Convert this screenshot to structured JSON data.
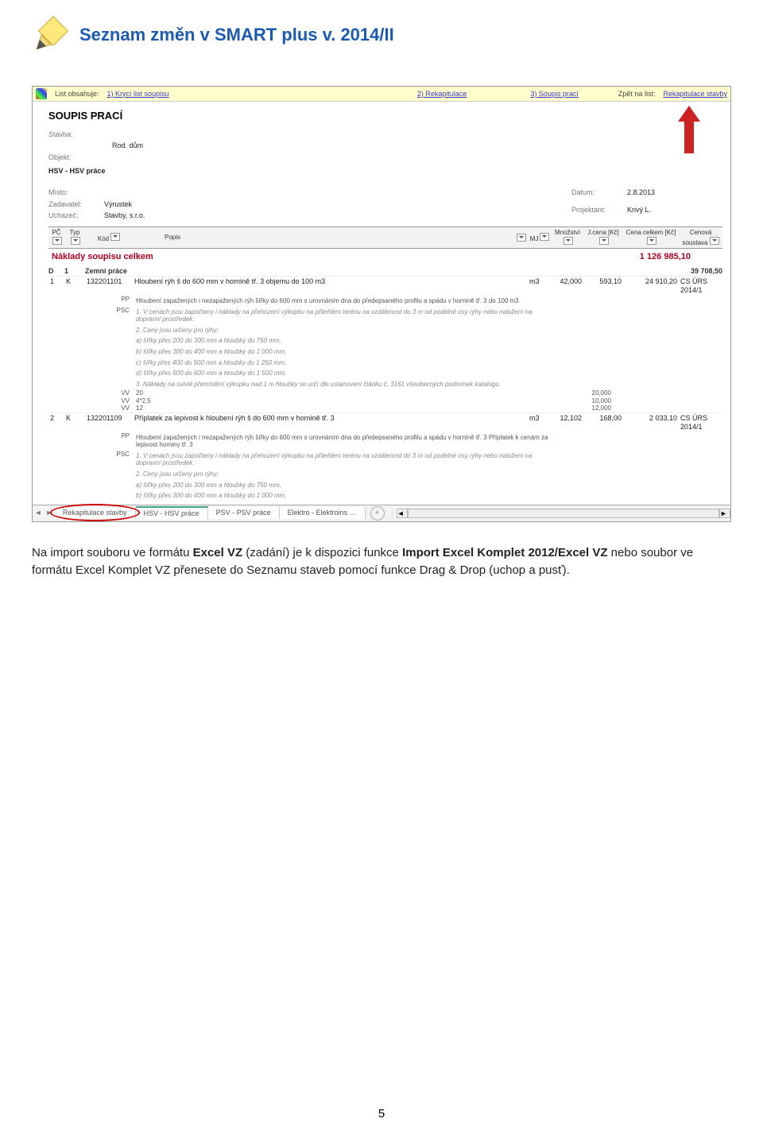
{
  "header": {
    "title": "Seznam změn v SMART plus v. 2014/II"
  },
  "nav": {
    "list_label": "List obsahuje:",
    "link1": "1) Krycí list soupisu",
    "link2": "2) Rekapitulace",
    "link3": "3) Soupis prací",
    "back_label": "Zpět na list:",
    "back_link": "Rekapitulace stavby"
  },
  "doc": {
    "title": "SOUPIS PRACÍ",
    "stavba_lbl": "Stavba:",
    "stavba_val": "Rod. dům",
    "objekt_lbl": "Objekt:",
    "objekt_val": "HSV - HSV práce",
    "misto_lbl": "Místo:",
    "datum_lbl": "Datum:",
    "datum_val": "2.8.2013",
    "zadavatel_lbl": "Zadavatel:",
    "zadavatel_val": "Výrustek",
    "projektant_lbl": "Projektant:",
    "projektant_val": "Krivý L.",
    "uchazec_lbl": "Uchazeč:",
    "uchazec_val": "Stavby, s.r.o."
  },
  "cols": {
    "pc": "PČ",
    "typ": "Typ",
    "kod": "Kód",
    "popis": "Popis",
    "mj": "MJ",
    "mnoz": "Množství",
    "jcena": "J.cena [Kč]",
    "celkem": "Cena celkem [Kč]",
    "soustava": "Cenová soustava"
  },
  "totals": {
    "label": "Náklady soupisu celkem",
    "value": "1 126 985,10"
  },
  "group1": {
    "d": "D",
    "n": "1",
    "name": "Zemní práce",
    "sum": "39 708,50"
  },
  "row1": {
    "pc": "1",
    "typ": "K",
    "kod": "132201101",
    "popis": "Hloubení rýh š do 600 mm v hornině tř. 3 objemu do 100 m3",
    "mj": "m3",
    "mnoz": "42,000",
    "jcena": "593,10",
    "celkem": "24 910,20",
    "soust": "CS ÚRS 2014/1",
    "d1": "Hloubení zapažených i nezapažených rýh šířky do 600 mm  s urovnáním dna do předepsaného profilu a spádu v hornině tř. 3  do 100 m3",
    "n1": "1. V cenách jsou započteny i náklady na přehození výkopku na přilehlém terénu na vzdálenost do 3 m od podélné osy rýhy nebo naložení na dopravní prostředek.",
    "n2": "2. Ceny jsou určeny pro rýhy:",
    "n3": "a) šířky přes 200 do 300 mm a hloubky do 750 mm,",
    "n4": "b) šířky přes 300 do 400 mm a hloubky do 1 000 mm,",
    "n5": "c) šířky přes 400 do 500 mm a hloubky do 1 250 mm,",
    "n6": "d) šířky přes 500 do 600 mm a hloubky do 1 500 mm.",
    "n7": "3. Náklady na svislé přemístění výkopku nad 1 m hloubky se určí dle ustanovení článku č. 3161 všeobecných podmínek katalogu.",
    "vv1_expr": "20",
    "vv1_val": "20,000",
    "vv2_expr": "4*2,5",
    "vv2_val": "10,000",
    "vv3_expr": "12",
    "vv3_val": "12,000"
  },
  "row2": {
    "pc": "2",
    "typ": "K",
    "kod": "132201109",
    "popis": "Příplatek za lepivost k hloubení rýh š do 600 mm v hornině tř. 3",
    "mj": "m3",
    "mnoz": "12,102",
    "jcena": "168,00",
    "celkem": "2 033,10",
    "soust": "CS ÚRS 2014/1",
    "d1": "Hloubení zapažených i nezapažených rýh šířky do 600 mm  s urovnáním dna do předepsaného profilu a spádu v hornině tř. 3  Příplatek k cenám za lepivost horniny tř. 3",
    "n1": "1. V cenách jsou započteny i náklady na přehození výkopku na přilehlém terénu na vzdálenost do 3 m od podélné osy rýhy nebo naložení na dopravní prostředek.",
    "n2": "2. Ceny jsou určeny pro rýhy:",
    "n3": "a) šířky přes 200 do 300 mm a hloubky do 750 mm,",
    "n4": "b) šířky přes 300 do 400 mm a hloubky do 1 000 mm,"
  },
  "tabs": {
    "t1": "Rekapitulace stavby",
    "t2": "HSV - HSV práce",
    "t3": "PSV - PSV práce",
    "t4": "Elektro - Elektroins …"
  },
  "vv": "VV",
  "pp": "PP",
  "psc": "PSC",
  "body": {
    "p1a": "Na import souboru ve formátu ",
    "p1b": "Excel VZ",
    "p1c": " (zadání) je k dispozici funkce ",
    "p1d": "Import Excel Komplet 2012/Excel VZ",
    "p1e": " nebo soubor ve formátu Excel Komplet VZ přenesete do Seznamu staveb pomocí funkce Drag & Drop (uchop a pusť)."
  },
  "pagenum": "5"
}
